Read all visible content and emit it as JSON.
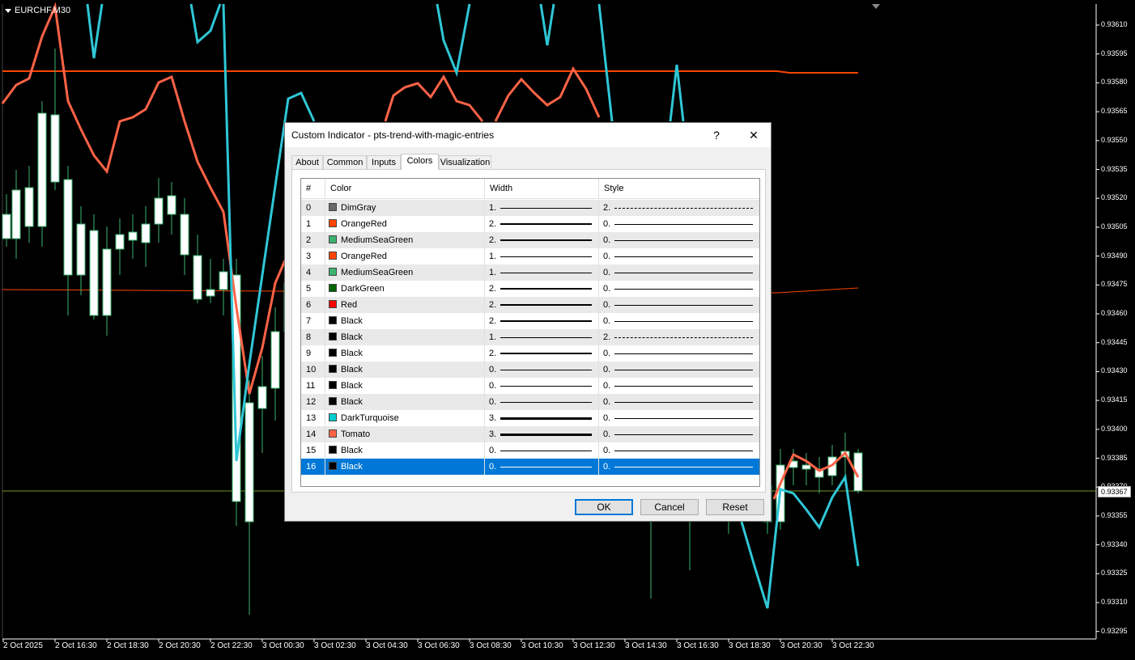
{
  "chart": {
    "symbol": "EURCHF,M30",
    "price_ticks": [
      "0.93610",
      "0.93595",
      "0.93580",
      "0.93565",
      "0.93550",
      "0.93535",
      "0.93520",
      "0.93505",
      "0.93490",
      "0.93475",
      "0.93460",
      "0.93445",
      "0.93430",
      "0.93415",
      "0.93400",
      "0.93385",
      "0.93370",
      "0.93355",
      "0.93340",
      "0.93325",
      "0.93310",
      "0.93295"
    ],
    "current_price": "0.93367",
    "time_ticks": [
      "2 Oct 2025",
      "2 Oct 16:30",
      "2 Oct 18:30",
      "2 Oct 20:30",
      "2 Oct 22:30",
      "3 Oct 00:30",
      "3 Oct 02:30",
      "3 Oct 04:30",
      "3 Oct 06:30",
      "3 Oct 08:30",
      "3 Oct 10:30",
      "3 Oct 12:30",
      "3 Oct 14:30",
      "3 Oct 16:30",
      "3 Oct 18:30",
      "3 Oct 20:30",
      "3 Oct 22:30"
    ],
    "colors": {
      "candle": "#ffffff",
      "wick": "#3cb371",
      "turquoise": "#2fc7d6",
      "tomato": "#ff6347",
      "orange_red": "#ff4500"
    }
  },
  "dialog": {
    "title": "Custom Indicator - pts-trend-with-magic-entries",
    "help_label": "?",
    "close_label": "✕",
    "tabs": [
      {
        "label": "About"
      },
      {
        "label": "Common"
      },
      {
        "label": "Inputs"
      },
      {
        "label": "Colors"
      },
      {
        "label": "Visualization"
      }
    ],
    "active_tab": "Colors",
    "columns": {
      "num": "#",
      "color": "Color",
      "width": "Width",
      "style": "Style"
    },
    "rows": [
      {
        "num": "0",
        "color": "DimGray",
        "hex": "#696969",
        "width": "1.",
        "style": "2."
      },
      {
        "num": "1",
        "color": "OrangeRed",
        "hex": "#ff4500",
        "width": "2.",
        "style": "0."
      },
      {
        "num": "2",
        "color": "MediumSeaGreen",
        "hex": "#3cb371",
        "width": "2.",
        "style": "0."
      },
      {
        "num": "3",
        "color": "OrangeRed",
        "hex": "#ff4500",
        "width": "1.",
        "style": "0."
      },
      {
        "num": "4",
        "color": "MediumSeaGreen",
        "hex": "#3cb371",
        "width": "1.",
        "style": "0."
      },
      {
        "num": "5",
        "color": "DarkGreen",
        "hex": "#006400",
        "width": "2.",
        "style": "0."
      },
      {
        "num": "6",
        "color": "Red",
        "hex": "#ff0000",
        "width": "2.",
        "style": "0."
      },
      {
        "num": "7",
        "color": "Black",
        "hex": "#000000",
        "width": "2.",
        "style": "0."
      },
      {
        "num": "8",
        "color": "Black",
        "hex": "#000000",
        "width": "1.",
        "style": "2."
      },
      {
        "num": "9",
        "color": "Black",
        "hex": "#000000",
        "width": "2.",
        "style": "0."
      },
      {
        "num": "10",
        "color": "Black",
        "hex": "#000000",
        "width": "0.",
        "style": "0."
      },
      {
        "num": "11",
        "color": "Black",
        "hex": "#000000",
        "width": "0.",
        "style": "0."
      },
      {
        "num": "12",
        "color": "Black",
        "hex": "#000000",
        "width": "0.",
        "style": "0."
      },
      {
        "num": "13",
        "color": "DarkTurquoise",
        "hex": "#00ced1",
        "width": "3.",
        "style": "0."
      },
      {
        "num": "14",
        "color": "Tomato",
        "hex": "#ff6347",
        "width": "3.",
        "style": "0."
      },
      {
        "num": "15",
        "color": "Black",
        "hex": "#000000",
        "width": "0.",
        "style": "0."
      },
      {
        "num": "16",
        "color": "Black",
        "hex": "#000000",
        "width": "0.",
        "style": "0."
      }
    ],
    "selected_row": "16",
    "buttons": {
      "ok": "OK",
      "cancel": "Cancel",
      "reset": "Reset"
    }
  }
}
